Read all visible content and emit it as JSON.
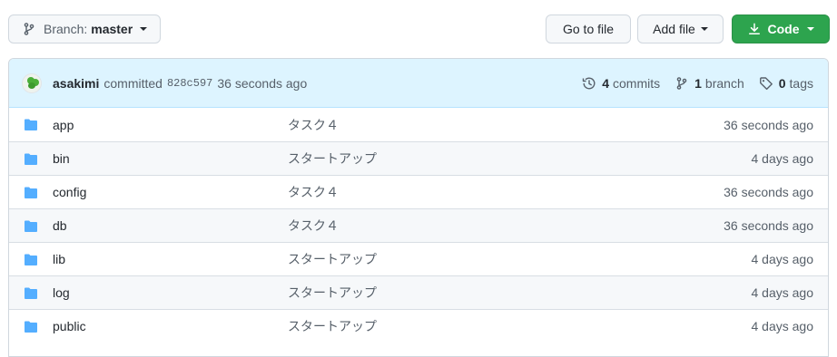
{
  "toolbar": {
    "branch_prefix": "Branch:",
    "branch_name": "master",
    "goto_file": "Go to file",
    "add_file": "Add file",
    "code": "Code"
  },
  "commit": {
    "author": "asakimi",
    "action": "committed",
    "sha": "828c597",
    "time": "36 seconds ago"
  },
  "stats": {
    "commits_count": "4",
    "commits_label": "commits",
    "branches_count": "1",
    "branches_label": "branch",
    "tags_count": "0",
    "tags_label": "tags"
  },
  "files": [
    {
      "name": "app",
      "message": "タスク４",
      "age": "36 seconds ago"
    },
    {
      "name": "bin",
      "message": "スタートアップ",
      "age": "4 days ago"
    },
    {
      "name": "config",
      "message": "タスク４",
      "age": "36 seconds ago"
    },
    {
      "name": "db",
      "message": "タスク４",
      "age": "36 seconds ago"
    },
    {
      "name": "lib",
      "message": "スタートアップ",
      "age": "4 days ago"
    },
    {
      "name": "log",
      "message": "スタートアップ",
      "age": "4 days ago"
    },
    {
      "name": "public",
      "message": "スタートアップ",
      "age": "4 days ago"
    }
  ],
  "colors": {
    "accent_green": "#2da44e",
    "folder_blue": "#54aeff",
    "commit_bar_bg": "#ddf4ff"
  },
  "icons": {
    "branch": "git-branch-icon",
    "download": "download-icon",
    "history": "history-icon",
    "tag": "tag-icon",
    "folder": "folder-icon"
  }
}
